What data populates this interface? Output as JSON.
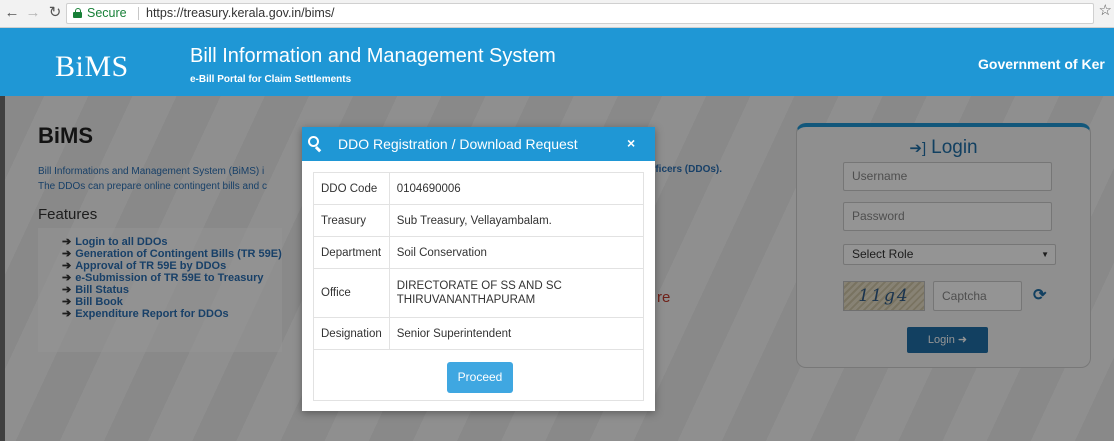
{
  "browser": {
    "secure_label": "Secure",
    "url": "https://treasury.kerala.gov.in/bims/"
  },
  "header": {
    "logo": "BiMS",
    "title": "Bill Information and Management System",
    "subtitle": "e-Bill Portal for Claim Settlements",
    "government": "Government of Ker"
  },
  "main": {
    "heading": "BiMS",
    "intro_line1": "Bill Informations and Management System (BiMS) i",
    "intro_line2": "The DDOs can prepare online contingent bills and c",
    "intro_right": "fficers (DDOs).",
    "features_heading": "Features",
    "features": [
      "Login to all DDOs",
      "Generation of Contingent Bills (TR 59E)",
      "Approval of TR 59E by DDOs",
      "e-Submission of TR 59E to Treasury",
      "Bill Status",
      "Bill Book",
      "Expenditure Report for DDOs"
    ],
    "partial_red_text": "re"
  },
  "login": {
    "title": "Login",
    "username_placeholder": "Username",
    "password_placeholder": "Password",
    "role_selected": "Select Role",
    "captcha_image_text": "11g4",
    "captcha_placeholder": "Captcha",
    "button": "Login"
  },
  "modal": {
    "title": "DDO Registration / Download Request",
    "close": "×",
    "rows": [
      {
        "key": "DDO Code",
        "value": "0104690006"
      },
      {
        "key": "Treasury",
        "value": "Sub Treasury, Vellayambalam."
      },
      {
        "key": "Department",
        "value": "Soil Conservation"
      },
      {
        "key": "Office",
        "value": "DIRECTORATE OF SS AND SC THIRUVANANTHAPURAM"
      },
      {
        "key": "Designation",
        "value": "Senior Superintendent"
      }
    ],
    "proceed": "Proceed"
  },
  "colors": {
    "header_blue": "#1f97d5",
    "link_blue": "#2a6fb3",
    "secure_green": "#188038"
  }
}
